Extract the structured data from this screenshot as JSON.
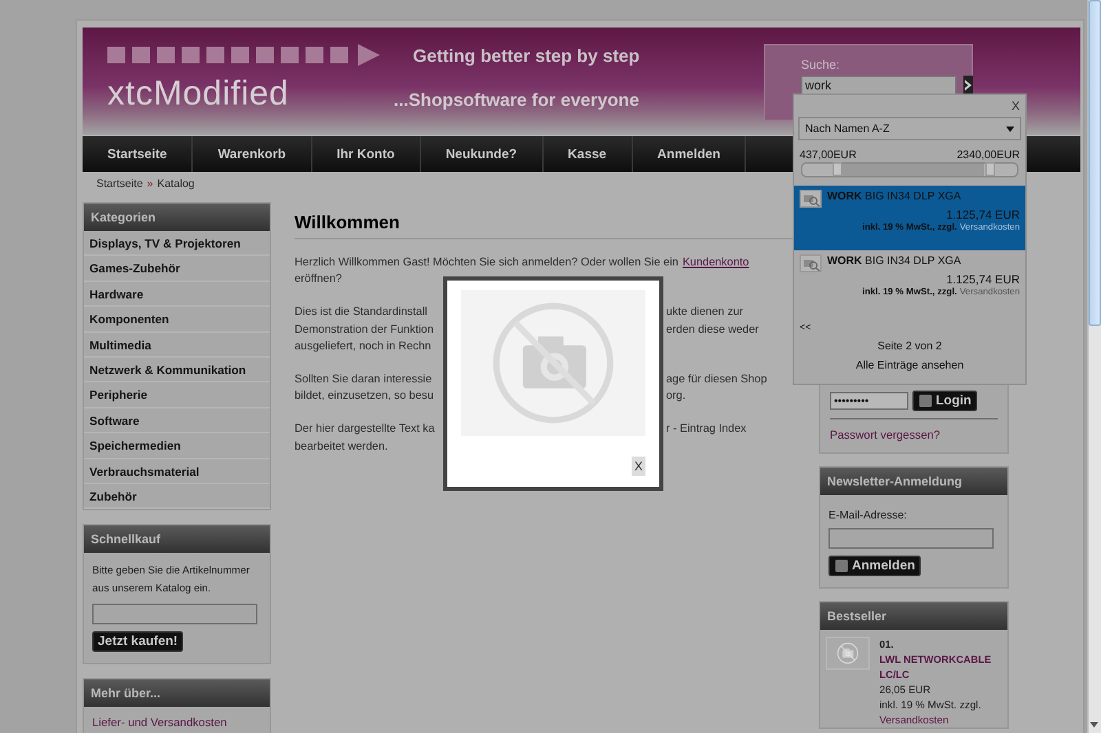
{
  "header": {
    "tagline": "Getting better step by step",
    "logo": "xtcModified",
    "slogan": "...Shopsoftware for everyone",
    "search_label": "Suche:",
    "search_value": "work"
  },
  "nav": [
    "Startseite",
    "Warenkorb",
    "Ihr Konto",
    "Neukunde?",
    "Kasse",
    "Anmelden"
  ],
  "breadcrumb": {
    "items": [
      "Startseite",
      "Katalog"
    ],
    "separator": "»"
  },
  "categories": {
    "title": "Kategorien",
    "items": [
      "Displays, TV & Projektoren",
      "Games-Zubehör",
      "Hardware",
      "Komponenten",
      "Multimedia",
      "Netzwerk & Kommunikation",
      "Peripherie",
      "Software",
      "Speichermedien",
      "Verbrauchsmaterial",
      "Zubehör"
    ]
  },
  "quick_buy": {
    "title": "Schnellkauf",
    "text": "Bitte geben Sie die Artikelnummer aus unserem Katalog ein.",
    "button": "Jetzt kaufen!"
  },
  "more_about": {
    "title": "Mehr über...",
    "links": [
      "Liefer- und Versandkosten"
    ]
  },
  "content": {
    "title": "Willkommen",
    "paragraphs": [
      [
        {
          "left": "Herzlich Willkommen Gast! Möchten Sie sich anmelden? Oder wollen Sie ein",
          "link": "Kundenkonto"
        },
        {
          "left": "eröffnen?"
        }
      ],
      [
        {
          "left": "Dies ist die Standardinstall",
          "right": "ukte dienen zur"
        },
        {
          "left": "Demonstration der Funktion",
          "right": "erden diese weder"
        },
        {
          "left": "ausgeliefert, noch in Rechn"
        }
      ],
      [
        {
          "left": "Sollten Sie daran interessie",
          "right": "age für diesen Shop"
        },
        {
          "left": "bildet, einzusetzen, so besu",
          "right": "org."
        }
      ],
      [
        {
          "left": "Der hier dargestellte Text ka",
          "right": "r - Eintrag Index"
        },
        {
          "left": "bearbeitet werden."
        }
      ]
    ]
  },
  "search_results": {
    "close": "X",
    "sort": "Nach Namen A-Z",
    "price_min": "437,00EUR",
    "price_max": "2340,00EUR",
    "range": {
      "min_handle": {
        "level": 0.16
      },
      "max_handle": {
        "level": 0.87
      }
    },
    "items": [
      {
        "name": "**WORK** BIG IN34 DLP XGA",
        "price": "1.125,74 EUR",
        "tax": "inkl. 19 % MwSt., zzgl.",
        "shipping": "Versandkosten",
        "selected": true
      },
      {
        "name": "**WORK** BIG IN34 DLP XGA",
        "price": "1.125,74 EUR",
        "tax": "inkl. 19 % MwSt., zzgl.",
        "shipping": "Versandkosten",
        "selected": false
      }
    ],
    "prev": "<<",
    "page": "Seite 2 von 2",
    "all": "Alle Einträge ansehen"
  },
  "login": {
    "password": "•••••••••",
    "button": "Login",
    "forgot": "Passwort vergessen?"
  },
  "newsletter": {
    "title": "Newsletter-Anmeldung",
    "email_label": "E-Mail-Adresse:",
    "button": "Anmelden"
  },
  "bestseller": {
    "title": "Bestseller",
    "items": [
      {
        "rank": "01.",
        "name": "LWL NETWORKCABLE LC/LC",
        "price": "26,05 EUR",
        "tax": "inkl. 19 % MwSt. zzgl.",
        "shipping": "Versandkosten"
      }
    ]
  },
  "modal": {
    "close": "X"
  }
}
